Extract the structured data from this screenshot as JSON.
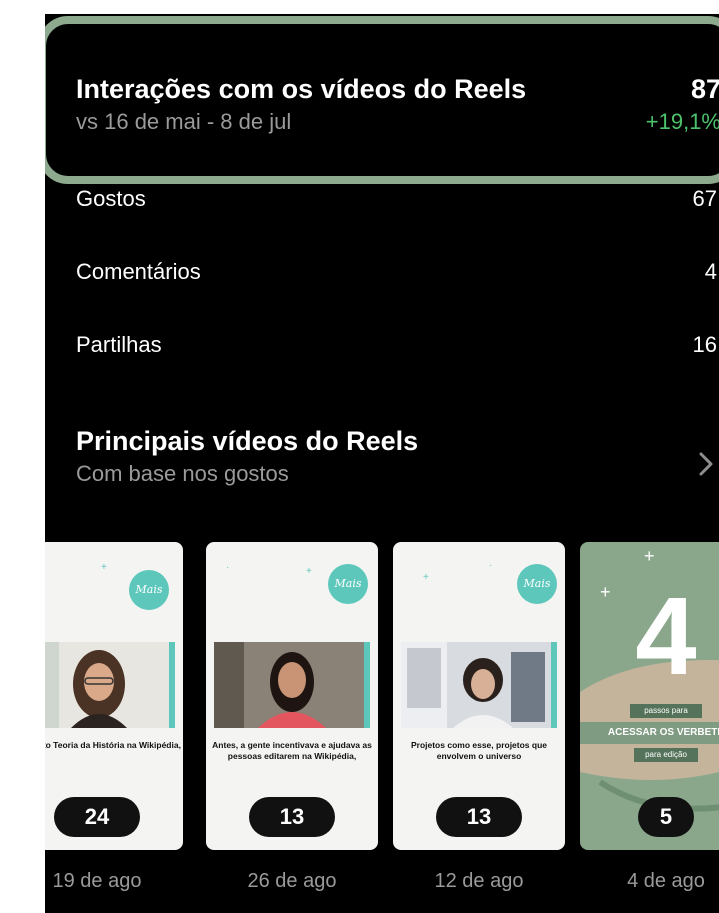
{
  "highlight": {
    "title": "Interações com os vídeos do Reels",
    "subtitle": "vs 16 de mai - 8 de jul",
    "value": "87",
    "delta": "+19,1%"
  },
  "metrics": [
    {
      "label": "Gostos",
      "value": "67"
    },
    {
      "label": "Comentários",
      "value": "4"
    },
    {
      "label": "Partilhas",
      "value": "16"
    }
  ],
  "top_reels": {
    "title": "Principais vídeos do Reels",
    "subtitle": "Com base nos gostos",
    "items": [
      {
        "caption": "O projeto Teoria da História na Wikipédia,",
        "count": "24",
        "date": "19 de ago",
        "logo": "Mais"
      },
      {
        "caption": "Antes, a gente incentivava e ajudava as pessoas editarem na Wikipédia,",
        "count": "13",
        "date": "26 de ago",
        "logo": "Mais"
      },
      {
        "caption": "Projetos como esse, projetos que envolvem o universo",
        "count": "13",
        "date": "12 de ago",
        "logo": "Mais"
      },
      {
        "big_number": "4",
        "top_text": "passos para",
        "banner": "ACESSAR OS VERBETE",
        "bottom_text": "para edição",
        "count": "5",
        "date": "4 de ago"
      }
    ]
  },
  "colors": {
    "highlight_border": "#8da98e",
    "delta_green": "#4cc26b",
    "teal_accent": "#5ec7bb"
  }
}
